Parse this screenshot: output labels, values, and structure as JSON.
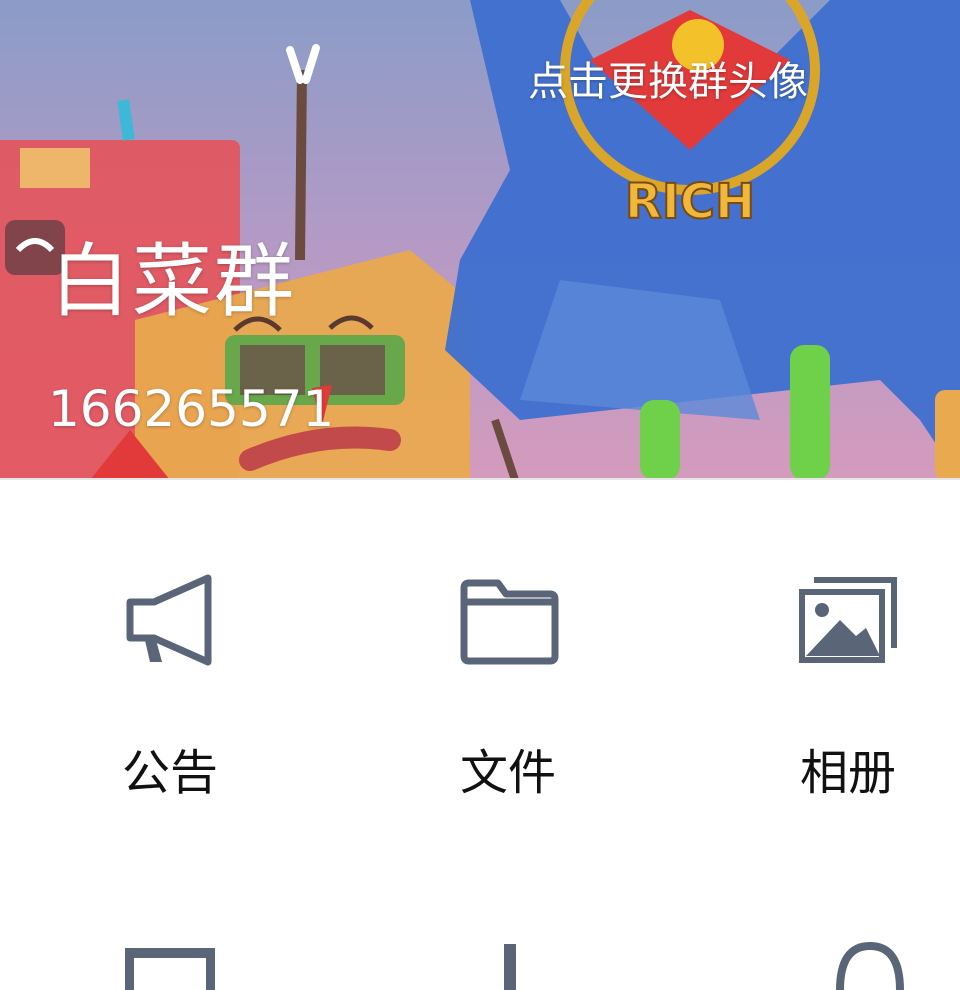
{
  "group": {
    "name": "白菜群",
    "number": "166265571",
    "change_avatar_label": "点击更换群头像"
  },
  "features": [
    {
      "label": "公告",
      "icon": "megaphone-icon"
    },
    {
      "label": "文件",
      "icon": "folder-icon"
    },
    {
      "label": "相册",
      "icon": "photo-album-icon"
    }
  ],
  "cover_art": {
    "badge_text": "RICH"
  },
  "colors": {
    "icon": "#5b6578",
    "label": "#111111",
    "cover_blue": "#3e6fd0"
  }
}
